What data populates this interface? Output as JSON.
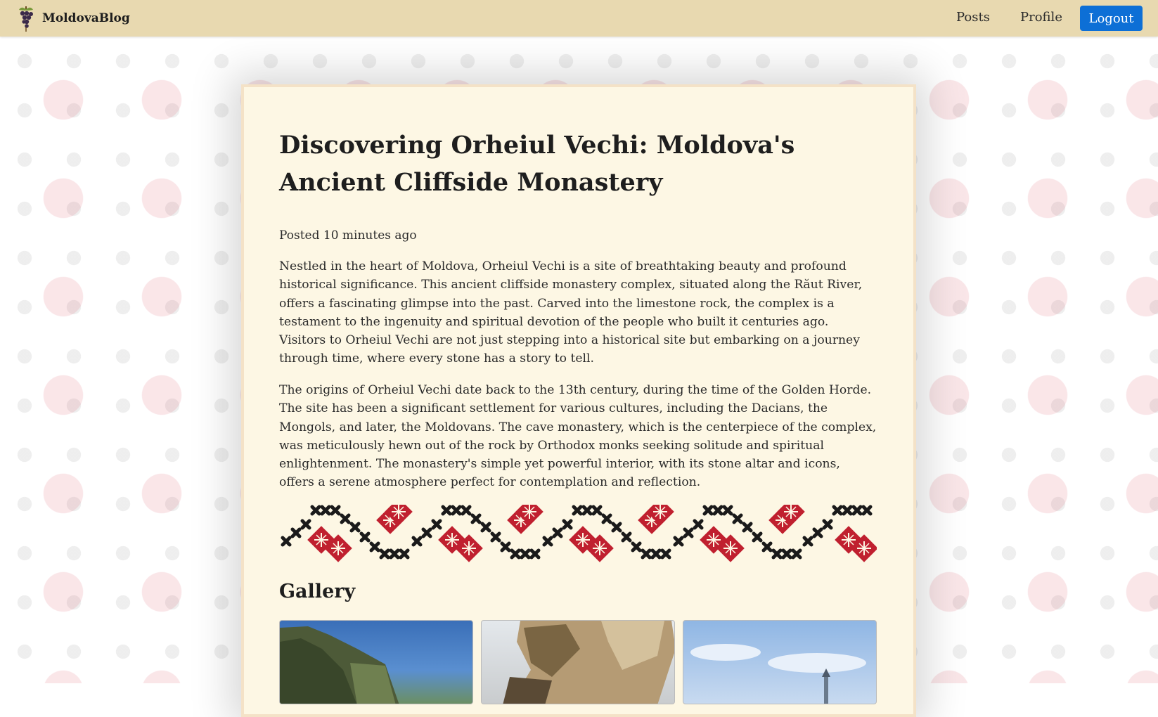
{
  "navbar": {
    "brand": "MoldovaBlog",
    "links": [
      "Posts",
      "Profile"
    ],
    "logout_label": "Logout",
    "accent": "#0d6fd6"
  },
  "post": {
    "title": "Discovering Orheiul Vechi: Moldova's Ancient Cliffside Monastery",
    "meta": "Posted 10 minutes ago",
    "paragraphs": [
      "Nestled in the heart of Moldova, Orheiul Vechi is a site of breathtaking beauty and profound historical significance. This ancient cliffside monastery complex, situated along the Răut River, offers a fascinating glimpse into the past. Carved into the limestone rock, the complex is a testament to the ingenuity and spiritual devotion of the people who built it centuries ago. Visitors to Orheiul Vechi are not just stepping into a historical site but embarking on a journey through time, where every stone has a story to tell.",
      "The origins of Orheiul Vechi date back to the 13th century, during the time of the Golden Horde. The site has been a significant settlement for various cultures, including the Dacians, the Mongols, and later, the Moldovans. The cave monastery, which is the centerpiece of the complex, was meticulously hewn out of the rock by Orthodox monks seeking solitude and spiritual enlightenment. The monastery's simple yet powerful interior, with its stone altar and icons, offers a serene atmosphere perfect for contemplation and reflection."
    ]
  },
  "gallery": {
    "title": "Gallery",
    "images": [
      "cliff-landscape",
      "limestone-cliff",
      "monastery-sky"
    ]
  },
  "colors": {
    "navbar_bg": "#e8d9b0",
    "card_bg": "#fdf7e4",
    "ornament_red": "#c0202f",
    "ornament_black": "#1a1a1a"
  }
}
